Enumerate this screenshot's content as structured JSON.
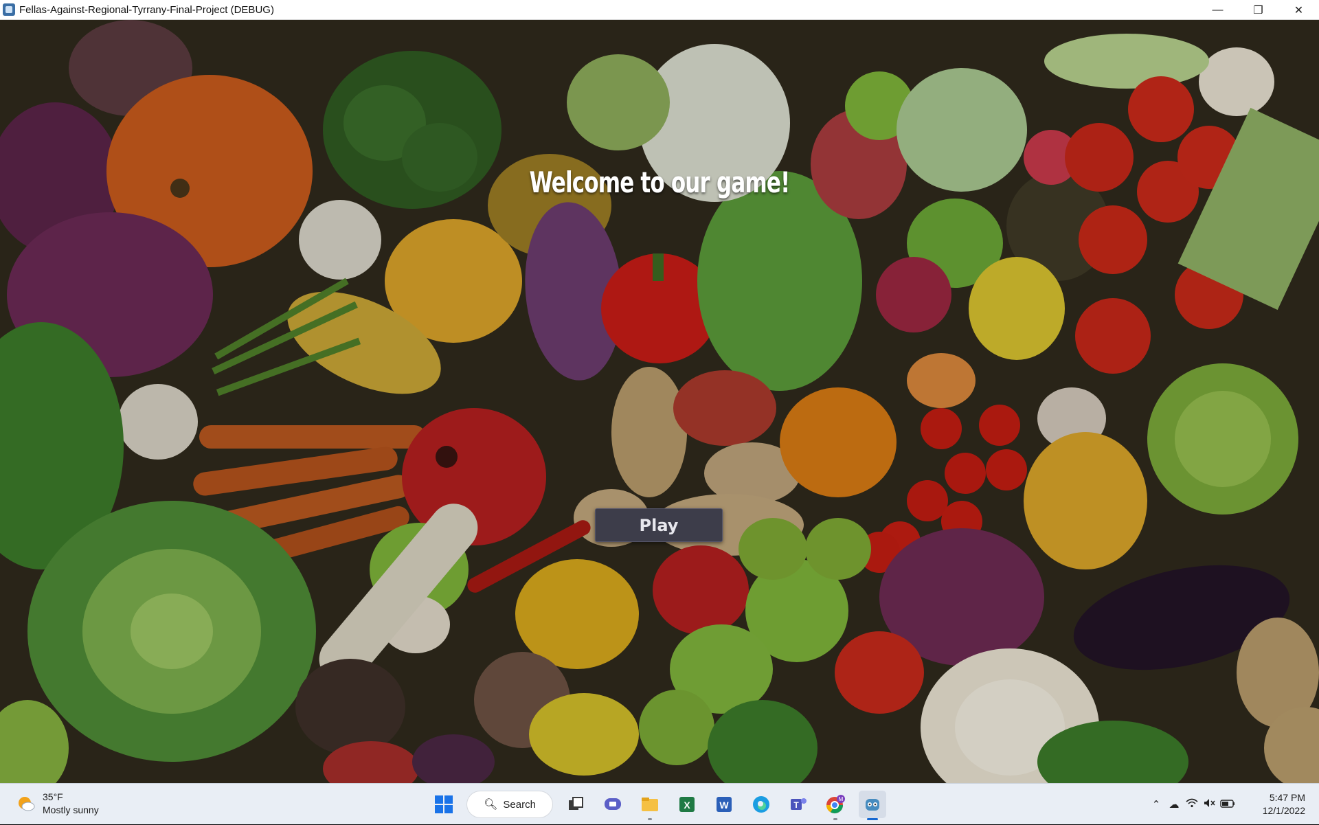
{
  "window": {
    "title": "Fellas-Against-Regional-Tyrrany-Final-Project (DEBUG)",
    "minimize_glyph": "—",
    "restore_glyph": "❐",
    "close_glyph": "✕"
  },
  "game": {
    "welcome_text": "Welcome to our game!",
    "play_label": "Play"
  },
  "taskbar": {
    "weather": {
      "temperature": "35°F",
      "condition": "Mostly sunny",
      "icon": "sun-cloud-icon"
    },
    "search_label": "Search",
    "pinned": [
      {
        "name": "start-icon"
      },
      {
        "name": "task-view-icon"
      },
      {
        "name": "chat-icon"
      },
      {
        "name": "file-explorer-icon"
      },
      {
        "name": "excel-icon"
      },
      {
        "name": "word-icon"
      },
      {
        "name": "edge-icon"
      },
      {
        "name": "teams-icon"
      },
      {
        "name": "chrome-icon"
      },
      {
        "name": "godot-icon"
      }
    ],
    "chrome_badge": "M",
    "clock": {
      "time": "5:47 PM",
      "date": "12/1/2022"
    }
  },
  "colors": {
    "play_button": "#3d3d4a",
    "taskbar": "#e9eef5",
    "accent": "#1668d1"
  }
}
